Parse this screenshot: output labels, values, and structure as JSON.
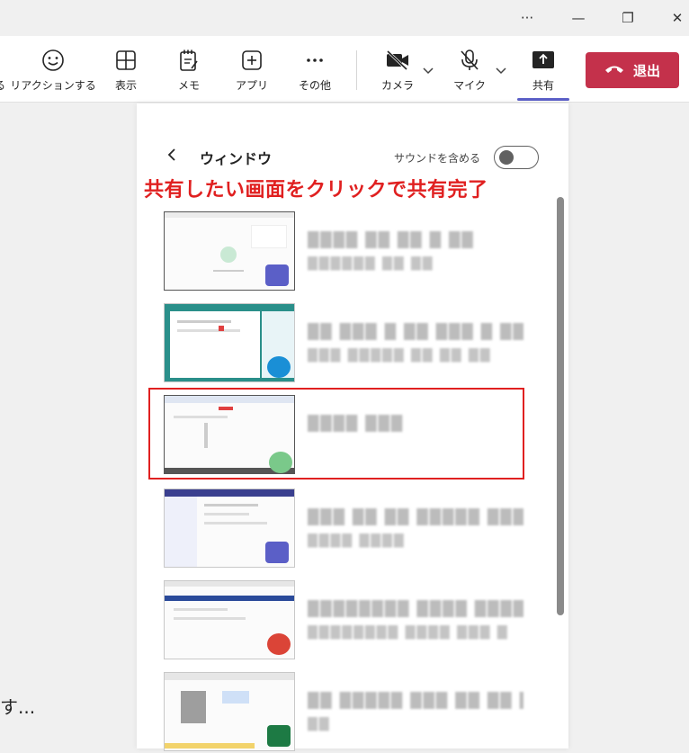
{
  "titlebar": {
    "more": "···",
    "minimize": "—",
    "restore": "❐",
    "close": "✕"
  },
  "toolbar": {
    "items": [
      {
        "label": "る",
        "icon": "unknown-icon"
      },
      {
        "label": "リアクションする",
        "icon": "smiley-icon"
      },
      {
        "label": "表示",
        "icon": "grid-icon"
      },
      {
        "label": "メモ",
        "icon": "notes-icon"
      },
      {
        "label": "アプリ",
        "icon": "add-app-icon"
      },
      {
        "label": "その他",
        "icon": "more-icon"
      },
      {
        "label": "カメラ",
        "icon": "camera-off-icon"
      },
      {
        "label": "マイク",
        "icon": "mic-off-icon"
      },
      {
        "label": "共有",
        "icon": "share-icon"
      }
    ],
    "leave_label": "退出",
    "leave_color": "#c4314b",
    "accent": "#5b5fc7"
  },
  "stage": {
    "partial_text": "す..."
  },
  "panel": {
    "title": "ウィンドウ",
    "sound_label": "サウンドを含める",
    "sound_on": false,
    "annotation": "共有したい画面をクリックで共有完了",
    "annotation_color": "#e02020",
    "windows": [
      {
        "title": "████ ██ ██ █ ██",
        "sub": "██████ ██ ██",
        "app": "teams-icon"
      },
      {
        "title": "██ ███ █ ██ ███ █ ██",
        "sub": "███ █████ ██ ██ ██",
        "app": "edge-icon"
      },
      {
        "title": "████ ███",
        "sub": "",
        "app": "paint-icon"
      },
      {
        "title": "███ ██ ██ █████ ███ █",
        "sub": "████ ████",
        "app": "teams-icon"
      },
      {
        "title": "████████ ████ █████",
        "sub": "████████ ████ ███ █",
        "app": "chrome-icon"
      },
      {
        "title": "██ █████ ███ ██ ██ ███",
        "sub": "██",
        "app": "excel-icon"
      }
    ]
  }
}
